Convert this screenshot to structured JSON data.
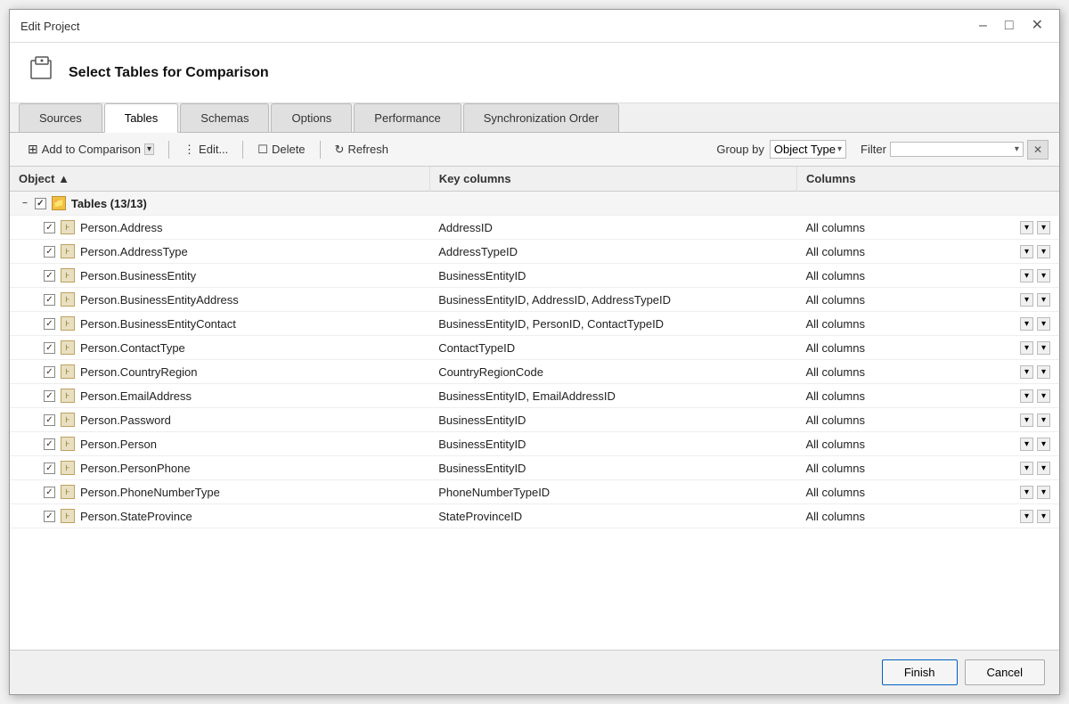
{
  "dialog": {
    "title": "Edit Project",
    "header_title": "Select Tables for Comparison"
  },
  "tabs": [
    {
      "id": "sources",
      "label": "Sources",
      "active": false
    },
    {
      "id": "tables",
      "label": "Tables",
      "active": true
    },
    {
      "id": "schemas",
      "label": "Schemas",
      "active": false
    },
    {
      "id": "options",
      "label": "Options",
      "active": false
    },
    {
      "id": "performance",
      "label": "Performance",
      "active": false
    },
    {
      "id": "sync_order",
      "label": "Synchronization Order",
      "active": false
    }
  ],
  "toolbar": {
    "add_to_comparison": "Add to Comparison",
    "edit": "Edit...",
    "delete": "Delete",
    "refresh": "Refresh",
    "group_by_label": "Group by",
    "group_by_value": "Object Type",
    "filter_label": "Filter",
    "filter_value": ""
  },
  "columns": {
    "object": "Object",
    "key_columns": "Key columns",
    "columns": "Columns"
  },
  "group": {
    "label": "Tables (13/13)"
  },
  "rows": [
    {
      "name": "Person.Address",
      "key": "AddressID",
      "columns": "All columns"
    },
    {
      "name": "Person.AddressType",
      "key": "AddressTypeID",
      "columns": "All columns"
    },
    {
      "name": "Person.BusinessEntity",
      "key": "BusinessEntityID",
      "columns": "All columns"
    },
    {
      "name": "Person.BusinessEntityAddress",
      "key": "BusinessEntityID, AddressID, AddressTypeID",
      "columns": "All columns"
    },
    {
      "name": "Person.BusinessEntityContact",
      "key": "BusinessEntityID, PersonID, ContactTypeID",
      "columns": "All columns"
    },
    {
      "name": "Person.ContactType",
      "key": "ContactTypeID",
      "columns": "All columns"
    },
    {
      "name": "Person.CountryRegion",
      "key": "CountryRegionCode",
      "columns": "All columns"
    },
    {
      "name": "Person.EmailAddress",
      "key": "BusinessEntityID, EmailAddressID",
      "columns": "All columns"
    },
    {
      "name": "Person.Password",
      "key": "BusinessEntityID",
      "columns": "All columns"
    },
    {
      "name": "Person.Person",
      "key": "BusinessEntityID",
      "columns": "All columns"
    },
    {
      "name": "Person.PersonPhone",
      "key": "BusinessEntityID",
      "columns": "All columns"
    },
    {
      "name": "Person.PhoneNumberType",
      "key": "PhoneNumberTypeID",
      "columns": "All columns"
    },
    {
      "name": "Person.StateProvince",
      "key": "StateProvinceID",
      "columns": "All columns"
    }
  ],
  "footer": {
    "finish": "Finish",
    "cancel": "Cancel"
  }
}
